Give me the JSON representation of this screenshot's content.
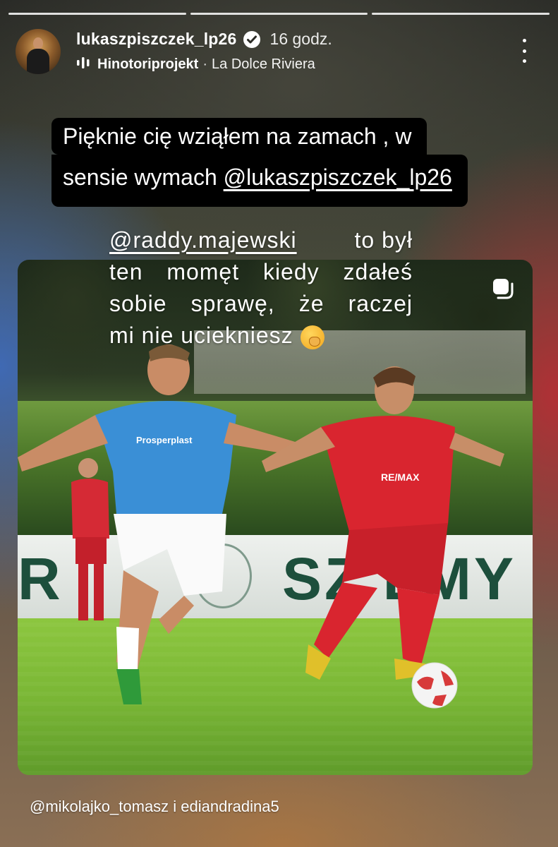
{
  "header": {
    "username": "lukaszpiszczek_lp26",
    "time": "16 godz.",
    "music_artist": "Hinotoriprojekt",
    "music_separator": "·",
    "music_track": "La Dolce Riviera"
  },
  "caption_top": {
    "line1": "Pięknie cię wziąłem na zamach , w",
    "line2_text": "sensie wymach ",
    "line2_mention": "@lukaszpiszczek_lp26"
  },
  "caption_photo": {
    "mention": "@raddy.majewski",
    "line1_rest": "to był",
    "line2": [
      "ten",
      "momęt",
      "kiedy",
      "zdałeś"
    ],
    "line3": [
      "sobie",
      "sprawę,",
      "że",
      "raczej"
    ],
    "line4": "mi nie uciekniesz"
  },
  "photo": {
    "banner_left": "R",
    "banner_right": "SZ  LMY",
    "jersey_blue_sponsor": "Prosperplast",
    "jersey_red_sponsor": "RE/MAX"
  },
  "tagged": "@mikolajko_tomasz i ediandradina5",
  "icons": [
    "verified-badge-icon",
    "music-bars-icon",
    "more-options-icon",
    "repost-icon",
    "face-with-hand-over-mouth-emoji"
  ]
}
